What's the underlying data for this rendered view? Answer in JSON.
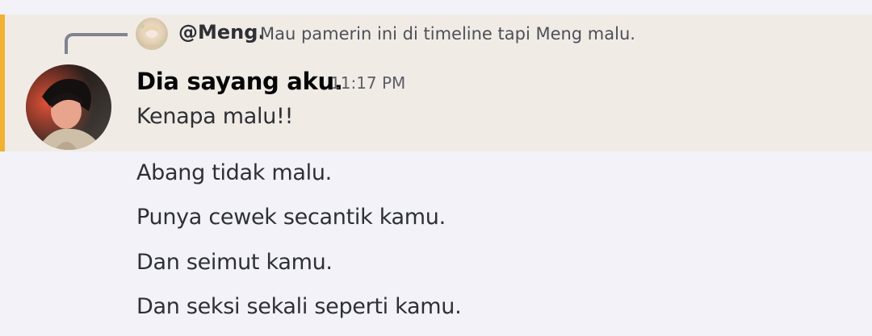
{
  "reply": {
    "author": "@Meng.",
    "content": "Mau pamerin ini di timeline tapi Meng malu."
  },
  "message": {
    "author": "Dia sayang aku.",
    "timestamp": "11:17 PM",
    "lines": [
      "Kenapa malu!!",
      "Abang tidak malu.",
      "Punya cewek secantik kamu.",
      "Dan seimut kamu.",
      "Dan seksi sekali seperti kamu."
    ]
  },
  "colors": {
    "highlight_background": "#f1ebe6",
    "highlight_accent": "#f0b232",
    "page_background": "#f2f2f8"
  },
  "icons": {
    "reply_avatar": "user-avatar-icon",
    "main_avatar": "user-avatar-icon"
  }
}
